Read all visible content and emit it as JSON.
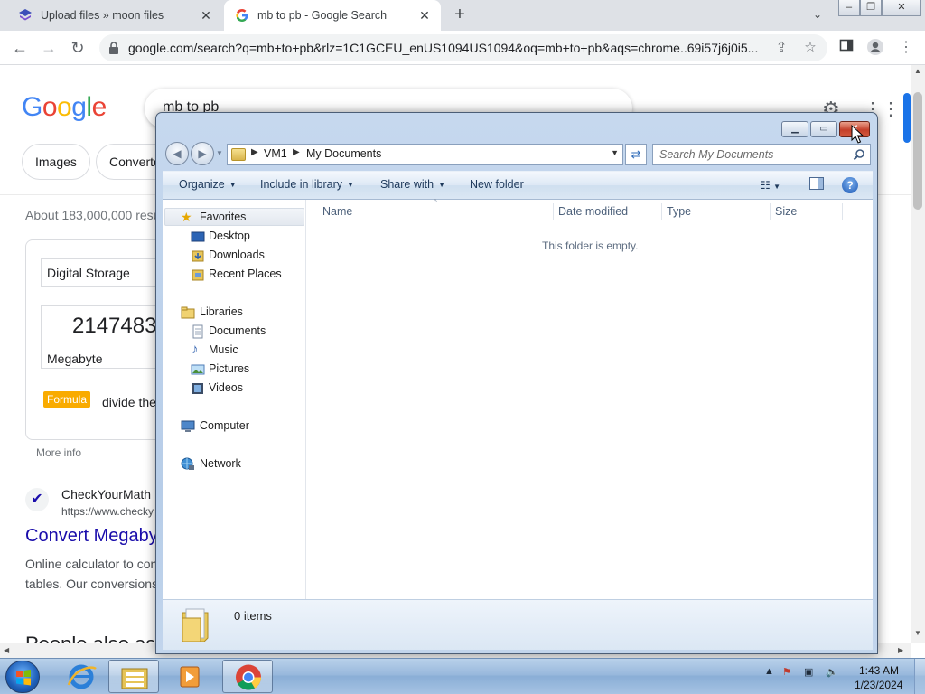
{
  "browser": {
    "tabs": [
      {
        "title": "Upload files » moon files",
        "active": false
      },
      {
        "title": "mb to pb - Google Search",
        "active": true
      }
    ],
    "url": "google.com/search?q=mb+to+pb&rlz=1C1GCEU_enUS1094US1094&oq=mb+to+pb&aqs=chrome..69i57j6j0i5..."
  },
  "google": {
    "logo": "Google",
    "query": "mb to pb",
    "chips": [
      "Images",
      "Converte"
    ],
    "stats": "About 183,000,000 resu",
    "converter": {
      "category": "Digital Storage",
      "value": "2147483",
      "unit": "Megabyte",
      "formula_badge": "Formula",
      "formula_text": "divide the",
      "more_info": "More info"
    },
    "result": {
      "site": "CheckYourMath",
      "url": "https://www.checky",
      "title": "Convert Megaby",
      "snippet_line1": "Online calculator to con",
      "snippet_line2": "tables. Our conversions"
    },
    "paa": "People also as"
  },
  "explorer": {
    "breadcrumb": [
      "VM1",
      "My Documents"
    ],
    "search_placeholder": "Search My Documents",
    "commands": {
      "organize": "Organize",
      "include_in_library": "Include in library",
      "share_with": "Share with",
      "new_folder": "New folder"
    },
    "nav": {
      "favorites": "Favorites",
      "desktop": "Desktop",
      "downloads": "Downloads",
      "recent_places": "Recent Places",
      "libraries": "Libraries",
      "documents": "Documents",
      "music": "Music",
      "pictures": "Pictures",
      "videos": "Videos",
      "computer": "Computer",
      "network": "Network"
    },
    "columns": {
      "name": "Name",
      "date_modified": "Date modified",
      "type": "Type",
      "size": "Size"
    },
    "empty_message": "This folder is empty.",
    "status": "0 items"
  },
  "taskbar": {
    "time": "1:43 AM",
    "date": "1/23/2024"
  },
  "colors": {
    "google_blue": "#4285F4",
    "google_red": "#EA4335",
    "google_yellow": "#FBBC05",
    "google_green": "#34A853",
    "link": "#1a0dab",
    "window_frame": "#b7cde8"
  }
}
